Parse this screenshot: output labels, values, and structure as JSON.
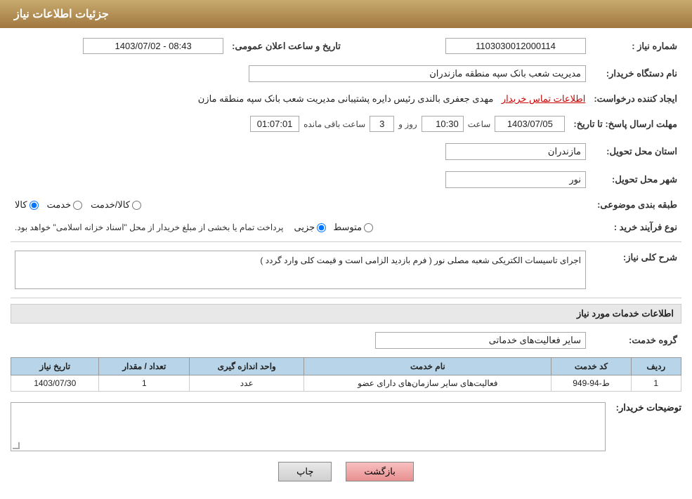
{
  "header": {
    "title": "جزئیات اطلاعات نیاز"
  },
  "fields": {
    "need_number_label": "شماره نیاز :",
    "need_number_value": "1103030012000114",
    "buyer_org_label": "نام دستگاه خریدار:",
    "buyer_org_value": "مدیریت شعب بانک سپه منطقه مازندران",
    "requester_label": "ایجاد کننده درخواست:",
    "requester_value": "مهدی جعفری بالندی رئیس دایره پشتیبانی مدیریت شعب بانک سپه منطقه مازن",
    "requester_link": "اطلاعات تماس خریدار",
    "deadline_label": "مهلت ارسال پاسخ: تا تاریخ:",
    "deadline_date": "1403/07/05",
    "deadline_time_label": "ساعت",
    "deadline_time": "10:30",
    "deadline_days_label": "روز و",
    "deadline_days": "3",
    "deadline_remaining_label": "ساعت باقی مانده",
    "deadline_remaining": "01:07:01",
    "province_label": "استان محل تحویل:",
    "province_value": "مازندران",
    "city_label": "شهر محل تحویل:",
    "city_value": "نور",
    "category_label": "طبقه بندی موضوعی:",
    "category_options": [
      "کالا",
      "خدمت",
      "کالا/خدمت"
    ],
    "category_selected": "کالا",
    "purchase_type_label": "نوع فرآیند خرید :",
    "purchase_options": [
      "جزیی",
      "متوسط"
    ],
    "purchase_note": "پرداخت تمام یا بخشی از مبلغ خریدار از محل \"اسناد خزانه اسلامی\" خواهد بود.",
    "announcement_label": "تاریخ و ساعت اعلان عمومی:",
    "announcement_value": "1403/07/02 - 08:43",
    "general_description_label": "شرح کلی نیاز:",
    "general_description_value": "اجرای تاسیسات الکتریکی شعبه مصلی نور ( فرم  بازدید الزامی است و قیمت کلی وارد گردد )",
    "services_section_label": "اطلاعات خدمات مورد نیاز",
    "service_group_label": "گروه خدمت:",
    "service_group_value": "سایر فعالیت‌های خدماتی",
    "table": {
      "headers": [
        "ردیف",
        "کد خدمت",
        "نام خدمت",
        "واحد اندازه گیری",
        "تعداد / مقدار",
        "تاریخ نیاز"
      ],
      "rows": [
        {
          "row": "1",
          "code": "ط-94-949",
          "name": "فعالیت‌های سایر سازمان‌های دارای عضو",
          "unit": "عدد",
          "quantity": "1",
          "date": "1403/07/30"
        }
      ]
    },
    "buyer_description_label": "توضیحات خریدار:",
    "buyer_description_value": ""
  },
  "buttons": {
    "print": "چاپ",
    "back": "بازگشت"
  }
}
